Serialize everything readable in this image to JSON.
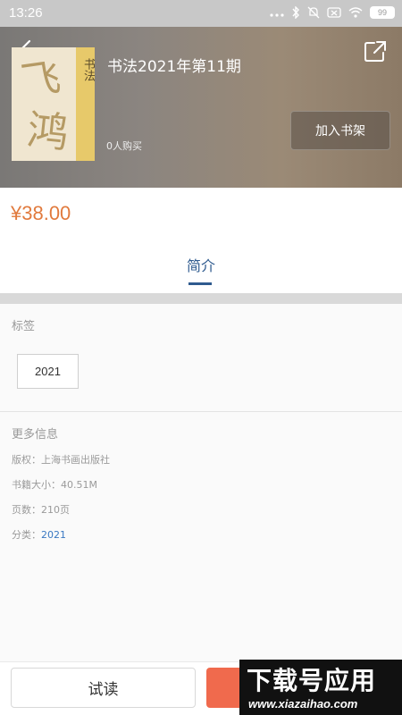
{
  "status_bar": {
    "time": "13:26",
    "battery": "99",
    "icons": [
      "more-dots-icon",
      "bluetooth-icon",
      "mute-icon",
      "sim-icon",
      "wifi-icon",
      "battery-icon"
    ]
  },
  "book": {
    "title": "书法2021年第11期",
    "buyers": "0人购买",
    "add_to_shelf": "加入书架",
    "price": "¥38.00"
  },
  "tabs": [
    {
      "label": "简介",
      "active": true
    }
  ],
  "tags_section": {
    "label": "标签",
    "tags": [
      "2021"
    ]
  },
  "more_info": {
    "label": "更多信息",
    "copyright": "版权：上海书画出版社",
    "size": "书籍大小：40.51M",
    "pages": "页数：210页",
    "category_label": "分类：",
    "category_value": "2021"
  },
  "bottom_bar": {
    "try_read": "试读"
  },
  "watermark": {
    "line1": "下载号应用",
    "line2": "www.xiazaihao.com"
  },
  "colors": {
    "price": "#e17a3d",
    "accent_blue": "#2f5b8f",
    "buy_button": "#f06a4d"
  }
}
